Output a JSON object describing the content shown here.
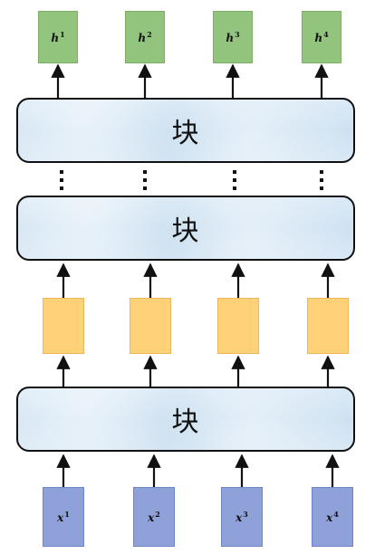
{
  "block_label": "块",
  "outputs": [
    {
      "base": "h",
      "sup": "1"
    },
    {
      "base": "h",
      "sup": "2"
    },
    {
      "base": "h",
      "sup": "3"
    },
    {
      "base": "h",
      "sup": "4"
    }
  ],
  "inputs": [
    {
      "base": "x",
      "sup": "1"
    },
    {
      "base": "x",
      "sup": "2"
    },
    {
      "base": "x",
      "sup": "3"
    },
    {
      "base": "x",
      "sup": "4"
    }
  ],
  "colors": {
    "output_box": "#93c47d",
    "intermediate_box": "#ffd27a",
    "input_box": "#8ea1d8",
    "block_fill": "#d4e5f3"
  }
}
